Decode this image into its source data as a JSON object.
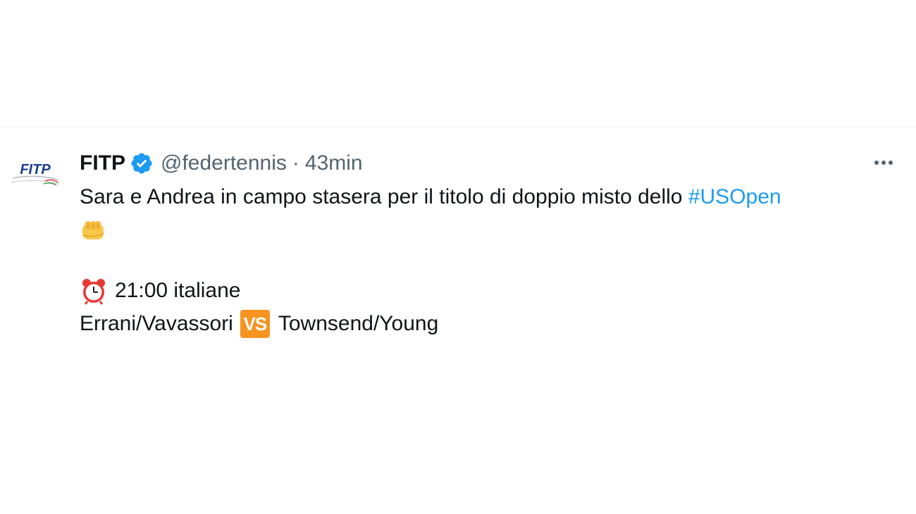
{
  "tweet": {
    "author": {
      "display_name": "FITP",
      "handle": "@federtennis",
      "verified": true,
      "avatar_text": "FITP"
    },
    "separator": "·",
    "time": "43min",
    "body": {
      "line1_text": "Sara e Andrea in campo stasera per il titolo di doppio misto dello ",
      "hashtag": "#USOpen",
      "line2_emoji": "fist-bump-icon",
      "time_text": "21:00 italiane",
      "team1": "Errani/Vavassori",
      "vs_label": "VS",
      "team2": "Townsend/Young"
    }
  },
  "colors": {
    "hashtag": "#1d9bf0",
    "muted": "#536471",
    "verified": "#1d9bf0",
    "vs_badge": "#f59420",
    "avatar_brand": "#1b3f8f"
  }
}
